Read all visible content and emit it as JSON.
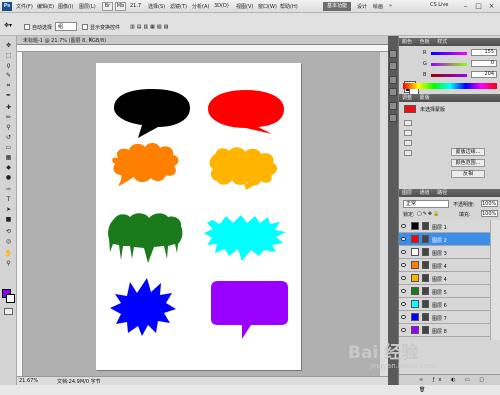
{
  "app": {
    "logo": "Ps",
    "menus": [
      "文件(F)",
      "编辑(E)",
      "图像(I)",
      "图层(L)",
      "选择(S)",
      "滤镜(T)",
      "分析(A)",
      "3D(D)",
      "视图(V)",
      "窗口(W)",
      "帮助(H)"
    ],
    "zoom": "21.7",
    "workspace_active": "基本功能",
    "workspace_links": [
      "设计",
      "绘画"
    ],
    "cs_live": "CS Live",
    "window_controls": [
      "–",
      "□",
      "×"
    ]
  },
  "options_bar": {
    "auto_select_label": "自动选择",
    "auto_select_value": "组",
    "show_transform_label": "显示变换控件"
  },
  "document": {
    "tab_title": "未标题-1 @ 21.7% (图层 8, RGB/8)",
    "zoom_status": "21.67%",
    "doc_size": "文档:24.9M/0 字节"
  },
  "speech_bubbles": [
    {
      "shape": "oval",
      "color": "#000000"
    },
    {
      "shape": "oval",
      "color": "#ff0000"
    },
    {
      "shape": "cloud",
      "color": "#ff7f00"
    },
    {
      "shape": "cloud",
      "color": "#ffb400"
    },
    {
      "shape": "dripping",
      "color": "#1b7a1b"
    },
    {
      "shape": "zigzag",
      "color": "#00ffff"
    },
    {
      "shape": "burst",
      "color": "#0000ff"
    },
    {
      "shape": "rectangle",
      "color": "#9900ff"
    }
  ],
  "color_panel": {
    "tabs": [
      "颜色",
      "色板",
      "样式"
    ],
    "sliders": [
      {
        "label": "R",
        "value": "155",
        "gradient": "linear-gradient(90deg,#0000ff,#ff00ff)"
      },
      {
        "label": "G",
        "value": "0",
        "gradient": "linear-gradient(90deg,#9900ff,#99ff00)"
      },
      {
        "label": "B",
        "value": "204",
        "gradient": "linear-gradient(90deg,#9b0000,#9b00ff)"
      }
    ]
  },
  "adjust_panel": {
    "tabs": [
      "调整",
      "蒙版"
    ],
    "style_name": "未选择蒙版",
    "buttons": [
      "蒙版边缘...",
      "颜色范围...",
      "反相"
    ]
  },
  "layers_panel": {
    "tabs": [
      "图层",
      "通道",
      "路径"
    ],
    "blend_mode": "正常",
    "opacity_label": "不透明度:",
    "opacity_value": "100%",
    "lock_label": "锁定:",
    "fill_label": "填充:",
    "fill_value": "100%",
    "layers": [
      {
        "name": "图层 1",
        "color": "#000000",
        "selected": false
      },
      {
        "name": "图层 2",
        "color": "#ff0000",
        "selected": true
      },
      {
        "name": "图层 3",
        "color": "#ffffff",
        "selected": false
      },
      {
        "name": "图层 4",
        "color": "#ff7f00",
        "selected": false
      },
      {
        "name": "图层 4",
        "color": "#ffb400",
        "selected": false
      },
      {
        "name": "图层 5",
        "color": "#1b7a1b",
        "selected": false
      },
      {
        "name": "图层 6",
        "color": "#00ffff",
        "selected": false
      },
      {
        "name": "图层 7",
        "color": "#0000ff",
        "selected": false
      },
      {
        "name": "图层 8",
        "color": "#9900ff",
        "selected": false
      }
    ]
  },
  "watermark": {
    "main": "Bai 经验",
    "sub": "jingyan.baidu.com"
  }
}
